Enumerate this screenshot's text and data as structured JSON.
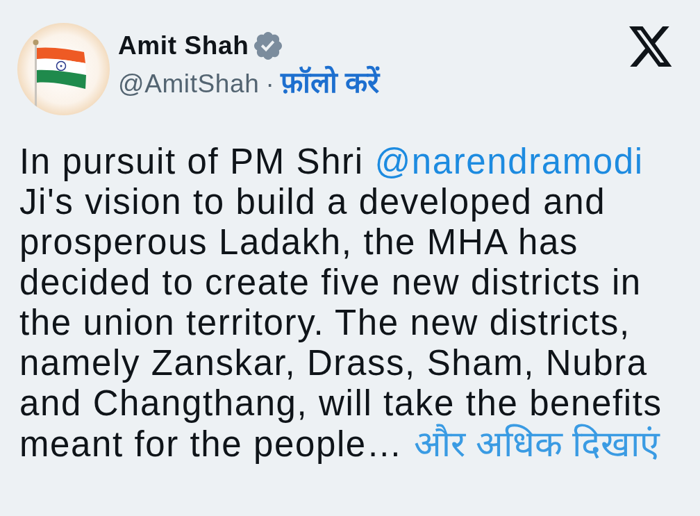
{
  "author": {
    "name": "Amit Shah",
    "verified": true,
    "handle": "@AmitShah",
    "separator": "·",
    "follow_label": "फ़ॉलो करें"
  },
  "tweet": {
    "segments": [
      {
        "kind": "text",
        "text": "In pursuit of PM Shri "
      },
      {
        "kind": "mention",
        "text": "@narendramodi"
      },
      {
        "kind": "text",
        "text": " Ji's vision to build a developed and prosperous Ladakh, the MHA has decided to create five new districts in the union territory. The new districts, namely Zanskar, Drass, Sham, Nubra and Changthang, will take the benefits meant for the people… "
      },
      {
        "kind": "more",
        "text": "और अधिक दिखाएं"
      }
    ]
  }
}
